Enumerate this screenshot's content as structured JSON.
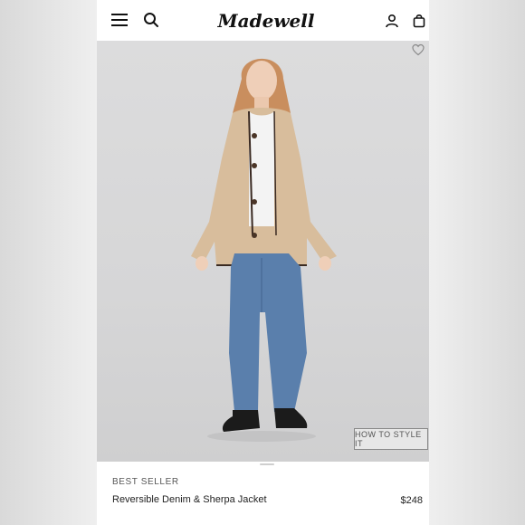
{
  "brand": {
    "logo_text": "Madewell"
  },
  "header": {
    "icons": [
      "menu-icon",
      "search-icon",
      "account-icon",
      "bag-icon"
    ]
  },
  "hero": {
    "favorite_icon": "heart-icon",
    "style_button_label": "HOW TO STYLE IT"
  },
  "product": {
    "badge": "BEST SELLER",
    "name": "Reversible Denim & Sherpa Jacket",
    "price": "$248"
  },
  "colors": {
    "background": "#ffffff",
    "text": "#222222",
    "hero_bg": "#d6d6d7",
    "jacket": "#d8bd9c",
    "denim": "#5a7fac"
  }
}
